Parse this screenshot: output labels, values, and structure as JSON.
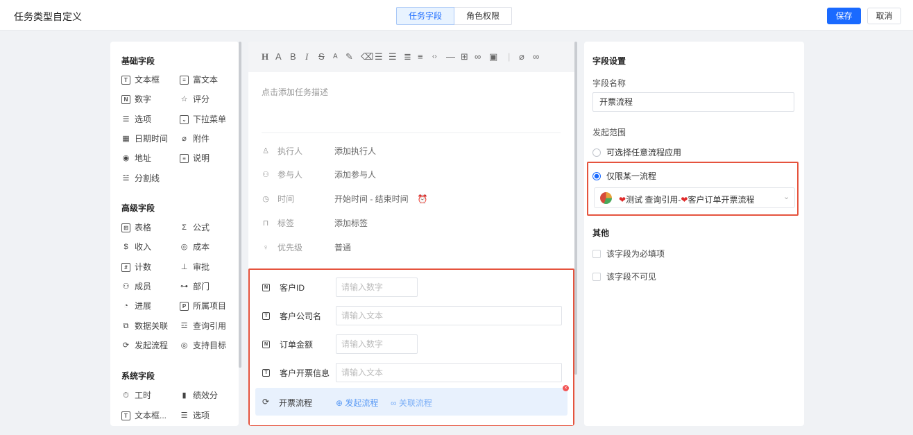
{
  "header": {
    "title": "任务类型自定义",
    "tabs": [
      {
        "label": "任务字段",
        "active": true
      },
      {
        "label": "角色权限",
        "active": false
      }
    ],
    "save_label": "保存",
    "cancel_label": "取消"
  },
  "field_library": {
    "basic": {
      "title": "基础字段",
      "items": [
        {
          "label": "文本框",
          "icon": "text-box-icon"
        },
        {
          "label": "富文本",
          "icon": "rich-text-icon"
        },
        {
          "label": "数字",
          "icon": "number-icon"
        },
        {
          "label": "评分",
          "icon": "star-icon"
        },
        {
          "label": "选项",
          "icon": "options-list-icon"
        },
        {
          "label": "下拉菜单",
          "icon": "dropdown-icon"
        },
        {
          "label": "日期时间",
          "icon": "calendar-icon"
        },
        {
          "label": "附件",
          "icon": "paperclip-icon"
        },
        {
          "label": "地址",
          "icon": "location-pin-icon"
        },
        {
          "label": "说明",
          "icon": "document-icon"
        },
        {
          "label": "分割线",
          "icon": "divider-icon"
        }
      ]
    },
    "advanced": {
      "title": "高级字段",
      "items": [
        {
          "label": "表格",
          "icon": "table-icon"
        },
        {
          "label": "公式",
          "icon": "sigma-icon"
        },
        {
          "label": "收入",
          "icon": "dollar-icon"
        },
        {
          "label": "成本",
          "icon": "cost-icon"
        },
        {
          "label": "计数",
          "icon": "counter-icon"
        },
        {
          "label": "审批",
          "icon": "approval-stamp-icon"
        },
        {
          "label": "成员",
          "icon": "members-icon"
        },
        {
          "label": "部门",
          "icon": "org-chart-icon"
        },
        {
          "label": "进展",
          "icon": "progress-pie-icon"
        },
        {
          "label": "所属项目",
          "icon": "project-icon"
        },
        {
          "label": "数据关联",
          "icon": "data-link-icon"
        },
        {
          "label": "查询引用",
          "icon": "query-icon"
        },
        {
          "label": "发起流程",
          "icon": "process-icon"
        },
        {
          "label": "支持目标",
          "icon": "target-icon"
        }
      ]
    },
    "system": {
      "title": "系统字段",
      "items": [
        {
          "label": "工时",
          "icon": "stopwatch-icon"
        },
        {
          "label": "绩效分",
          "icon": "bar-chart-icon"
        },
        {
          "label": "文本框...",
          "icon": "text-box-icon"
        },
        {
          "label": "选项",
          "icon": "options-list-icon"
        }
      ]
    }
  },
  "editor": {
    "description_placeholder": "点击添加任务描述",
    "meta_rows": [
      {
        "label": "执行人",
        "value": "添加执行人",
        "icon": "person-icon"
      },
      {
        "label": "参与人",
        "value": "添加参与人",
        "icon": "people-icon"
      },
      {
        "label": "时间",
        "value": "开始时间 - 结束时间",
        "icon": "clock-icon"
      },
      {
        "label": "标签",
        "value": "添加标签",
        "icon": "bookmark-icon"
      },
      {
        "label": "优先级",
        "value": "普通",
        "icon": "bulb-icon"
      }
    ],
    "custom_fields": [
      {
        "label": "客户ID",
        "placeholder": "请输入数字",
        "icon": "number-icon"
      },
      {
        "label": "客户公司名",
        "placeholder": "请输入文本",
        "icon": "text-box-icon"
      },
      {
        "label": "订单金额",
        "placeholder": "请输入数字",
        "icon": "number-icon"
      },
      {
        "label": "客户开票信息",
        "placeholder": "请输入文本",
        "icon": "text-box-icon"
      }
    ],
    "flow_field": {
      "label": "开票流程",
      "start_link": "发起流程",
      "relate_link": "关联流程"
    }
  },
  "settings": {
    "title": "字段设置",
    "name_label": "字段名称",
    "name_value": "开票流程",
    "scope_label": "发起范围",
    "scope_options": [
      {
        "label": "可选择任意流程应用",
        "checked": false
      },
      {
        "label": "仅限某一流程",
        "checked": true
      }
    ],
    "selected_flow": {
      "part1": "测试 查询引用-",
      "part2": "客户订单开票流程"
    },
    "other_title": "其他",
    "checkboxes": [
      {
        "label": "该字段为必填项",
        "checked": false
      },
      {
        "label": "该字段不可见",
        "checked": false
      }
    ]
  },
  "colors": {
    "primary": "#1a6aff",
    "highlight_border": "#e5533d",
    "flow_row_bg": "#e8f1fd"
  }
}
